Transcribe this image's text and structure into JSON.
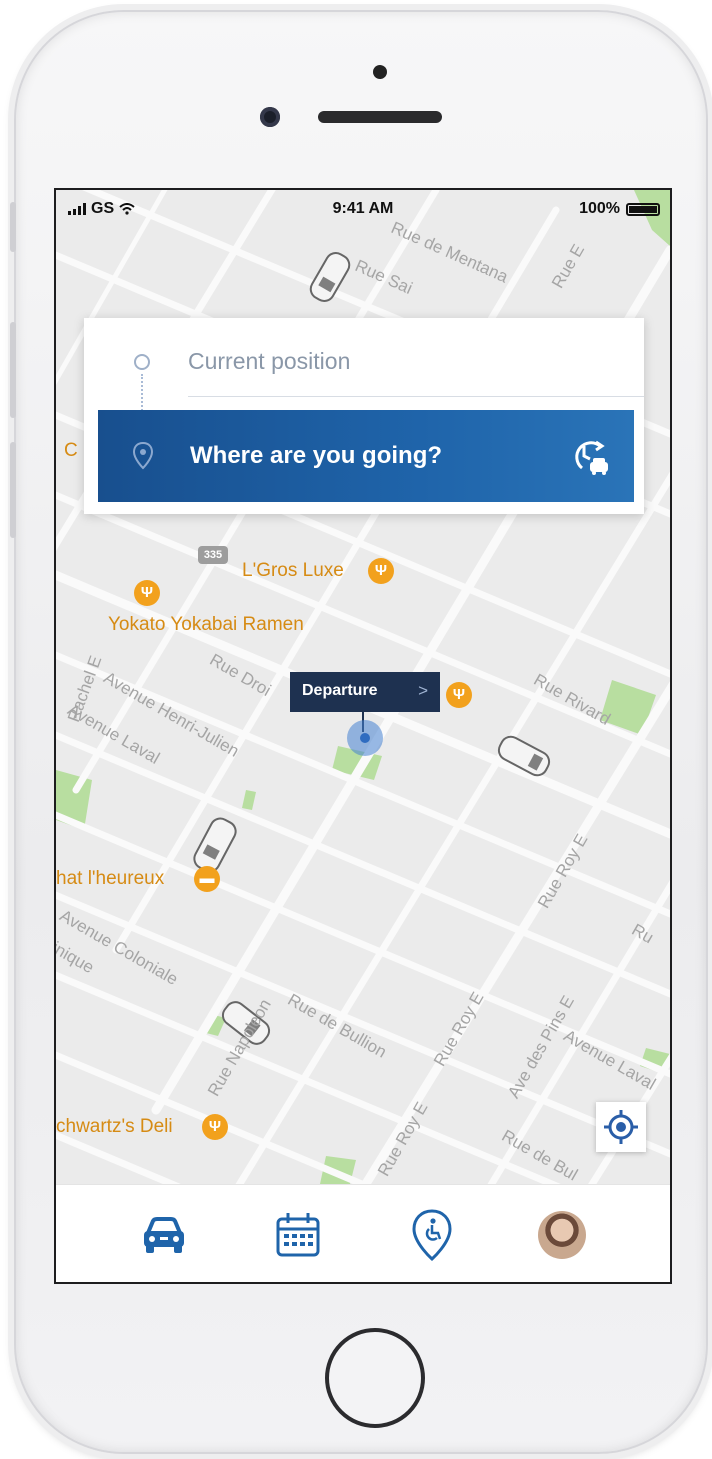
{
  "status_bar": {
    "carrier": "GS",
    "time": "9:41 AM",
    "battery": "100%"
  },
  "search": {
    "origin_label": "Current position",
    "destination_label": "Where are you going?"
  },
  "map": {
    "pois": [
      {
        "name": "L'Gros Luxe"
      },
      {
        "name": "Yokato Yokabai Ramen"
      },
      {
        "name": "hat l'heureux"
      },
      {
        "name": "chwartz's Deli"
      },
      {
        "name": "C"
      }
    ],
    "streets": [
      "Rue de Mentana",
      "Rue Sai",
      "Avenue Henri-Julien",
      "Avenue Laval",
      "Rue Droi",
      "Rue Rivard",
      "Rue Roy E",
      "Avenue Coloniale",
      "Rue de Bullion",
      "Rue Roy E",
      "Ave des Pins E",
      "Avenue Laval",
      "Rue Napoleon",
      "Rue Roy E",
      "Rue de Bul",
      "Rachel E",
      "inique",
      "Ru",
      "Rue E"
    ],
    "departure_label": "Departure",
    "route_badge": "335"
  },
  "tabs": [
    {
      "name": "car-icon"
    },
    {
      "name": "calendar-icon"
    },
    {
      "name": "accessibility-pin-icon"
    },
    {
      "name": "avatar"
    }
  ],
  "colors": {
    "primary": "#1f64aa",
    "poi": "#d68b14",
    "tag": "#1e3150"
  }
}
